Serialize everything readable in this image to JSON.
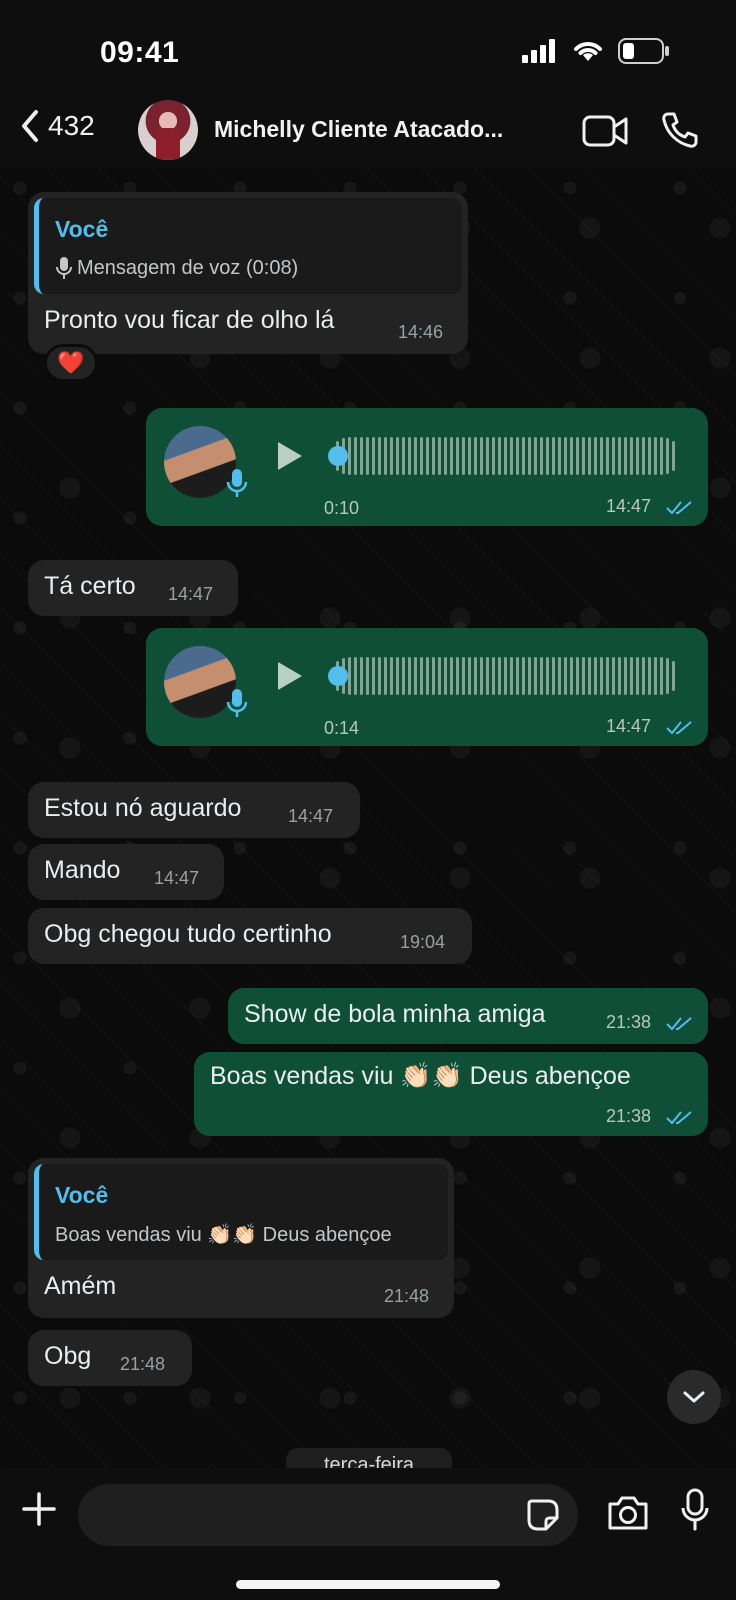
{
  "status_bar": {
    "time": "09:41"
  },
  "header": {
    "back_count": "432",
    "contact_name": "Michelly Cliente Atacado..."
  },
  "messages": [
    {
      "id": "m1",
      "direction": "in",
      "quote_author": "Você",
      "quote_text": "Mensagem de voz (0:08)",
      "text": "Pronto vou ficar de olho lá",
      "time": "14:46",
      "reaction": "❤️"
    },
    {
      "id": "m2",
      "direction": "out",
      "type": "voice",
      "duration": "0:10",
      "time": "14:47"
    },
    {
      "id": "m3",
      "direction": "in",
      "text": "Tá certo",
      "time": "14:47"
    },
    {
      "id": "m4",
      "direction": "out",
      "type": "voice",
      "duration": "0:14",
      "time": "14:47"
    },
    {
      "id": "m5",
      "direction": "in",
      "text": "Estou nó aguardo",
      "time": "14:47"
    },
    {
      "id": "m6",
      "direction": "in",
      "text": "Mando",
      "time": "14:47"
    },
    {
      "id": "m7",
      "direction": "in",
      "text": "Obg chegou tudo certinho",
      "time": "19:04"
    },
    {
      "id": "m8",
      "direction": "out",
      "text": "Show de bola minha amiga",
      "time": "21:38"
    },
    {
      "id": "m9",
      "direction": "out",
      "text": "Boas vendas viu 👏🏻👏🏻 Deus abençoe",
      "time": "21:38"
    },
    {
      "id": "m10",
      "direction": "in",
      "quote_author": "Você",
      "quote_text": "Boas vendas viu 👏🏻👏🏻 Deus abençoe",
      "text": "Amém",
      "time": "21:48"
    },
    {
      "id": "m11",
      "direction": "in",
      "text": "Obg",
      "time": "21:48"
    }
  ],
  "day_divider": "terça-feira",
  "composer": {
    "placeholder": ""
  },
  "colors": {
    "incoming": "#232323",
    "outgoing": "#0f4f37",
    "accent": "#53bdeb",
    "read_ticks": "#53bdeb"
  },
  "icons": [
    "back-chevron-icon",
    "video-call-icon",
    "phone-call-icon",
    "plus-icon",
    "sticker-icon",
    "camera-icon",
    "microphone-icon",
    "chevron-down-icon",
    "play-icon",
    "double-check-icon"
  ]
}
